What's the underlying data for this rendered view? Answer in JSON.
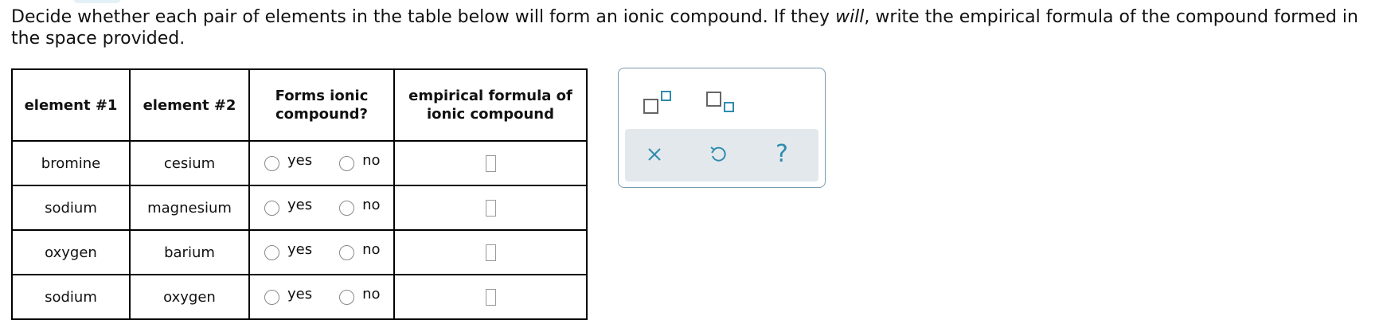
{
  "question": {
    "part1": "Decide whether each pair of elements in the table below will form an ionic compound. If they ",
    "emph": "will",
    "part2": ", write the empirical formula of the compound formed in the space provided."
  },
  "table": {
    "headers": {
      "element1": "element #1",
      "element2": "element #2",
      "forms": "Forms ionic compound?",
      "formula": "empirical formula of ionic compound"
    },
    "rows": [
      {
        "element1": "bromine",
        "element2": "cesium",
        "yes": "yes",
        "no": "no"
      },
      {
        "element1": "sodium",
        "element2": "magnesium",
        "yes": "yes",
        "no": "no"
      },
      {
        "element1": "oxygen",
        "element2": "barium",
        "yes": "yes",
        "no": "no"
      },
      {
        "element1": "sodium",
        "element2": "oxygen",
        "yes": "yes",
        "no": "no"
      }
    ]
  },
  "tools": {
    "superscript_icon": "superscript-box-icon",
    "subscript_icon": "subscript-box-icon",
    "clear_icon": "x-icon",
    "undo_icon": "undo-icon",
    "help_glyph": "?",
    "accent_color": "#2f8cae"
  }
}
